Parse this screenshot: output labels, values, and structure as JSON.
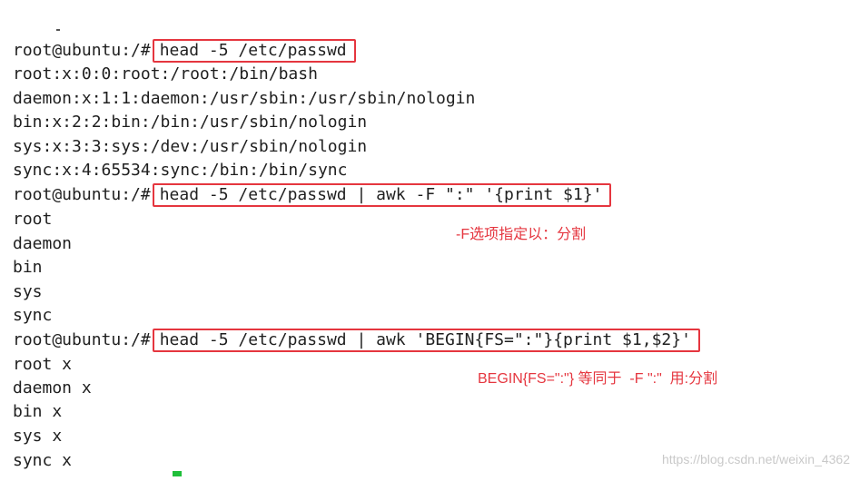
{
  "terminal": {
    "prompt": "root@ubuntu:/#",
    "commands": [
      "head -5 /etc/passwd",
      "head -5 /etc/passwd | awk -F \":\" '{print $1}'",
      "head -5 /etc/passwd | awk 'BEGIN{FS=\":\"}{print $1,$2}'"
    ],
    "output1": [
      "root:x:0:0:root:/root:/bin/bash",
      "daemon:x:1:1:daemon:/usr/sbin:/usr/sbin/nologin",
      "bin:x:2:2:bin:/bin:/usr/sbin/nologin",
      "sys:x:3:3:sys:/dev:/usr/sbin/nologin",
      "sync:x:4:65534:sync:/bin:/bin/sync"
    ],
    "output2": [
      "root",
      "daemon",
      "bin",
      "sys",
      "sync"
    ],
    "output3": [
      "root x",
      "daemon x",
      "bin x",
      "sys x",
      "sync x"
    ]
  },
  "annotations": {
    "note1": "-F选项指定以：分割",
    "note2": "BEGIN{FS=\":\"} 等同于  -F \":\"  用:分割"
  },
  "watermark": "https://blog.csdn.net/weixin_4362",
  "colors": {
    "highlight": "#e5363f",
    "cursor": "#1fbf3a"
  }
}
